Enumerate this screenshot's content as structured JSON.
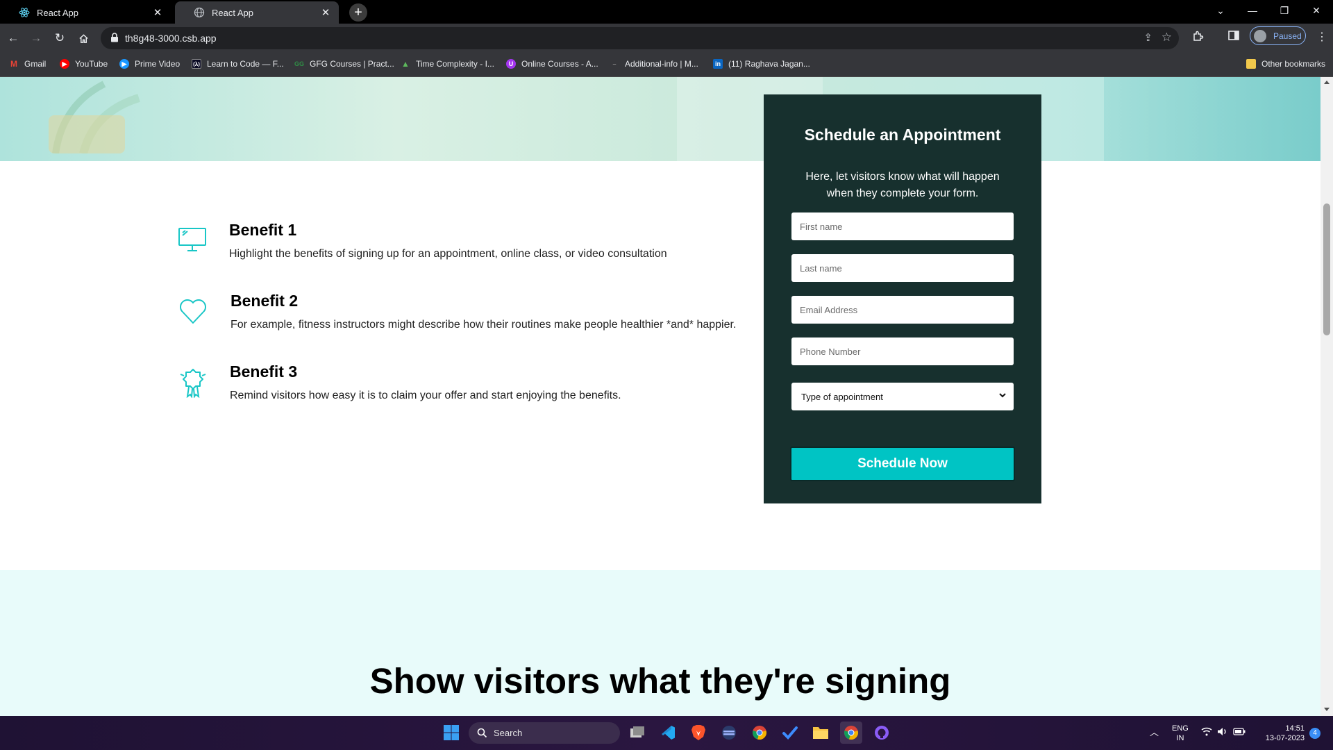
{
  "browser": {
    "tabs": [
      {
        "title": "React App",
        "active": false
      },
      {
        "title": "React App",
        "active": true
      }
    ],
    "url": "th8g48-3000.csb.app",
    "profile_status": "Paused",
    "bookmarks": [
      {
        "label": "Gmail",
        "icon": "gmail-icon",
        "color": "#ea4335"
      },
      {
        "label": "YouTube",
        "icon": "youtube-icon",
        "color": "#ff0000"
      },
      {
        "label": "Prime Video",
        "icon": "prime-video-icon",
        "color": "#1a98ff"
      },
      {
        "label": "Learn to Code — F...",
        "icon": "freecodecamp-icon",
        "color": "#0a0a23"
      },
      {
        "label": "GFG Courses | Pract...",
        "icon": "gfg-icon",
        "color": "#2f8d46"
      },
      {
        "label": "Time Complexity - I...",
        "icon": "mountain-icon",
        "color": "#5cb85c"
      },
      {
        "label": "Online Courses - A...",
        "icon": "udemy-icon",
        "color": "#a435f0"
      },
      {
        "label": "Additional-info | M...",
        "icon": "dash-icon",
        "color": "#555555"
      },
      {
        "label": "(11) Raghava Jagan...",
        "icon": "linkedin-icon",
        "color": "#0a66c2"
      }
    ],
    "other_bookmarks": "Other bookmarks"
  },
  "page": {
    "benefits": [
      {
        "title": "Benefit 1",
        "desc": "Highlight the benefits of signing up for an appointment, online class, or video consultation",
        "icon": "monitor-icon"
      },
      {
        "title": "Benefit 2",
        "desc": "For example, fitness instructors might describe how their routines make people healthier *and* happier.",
        "icon": "heart-icon"
      },
      {
        "title": "Benefit 3",
        "desc": "Remind visitors how easy it is to claim your offer and start enjoying the benefits.",
        "icon": "award-icon"
      }
    ],
    "form": {
      "title": "Schedule an Appointment",
      "subtitle": "Here, let visitors know what will happen when they complete your form.",
      "first_name_placeholder": "First name",
      "last_name_placeholder": "Last name",
      "email_placeholder": "Email Address",
      "phone_placeholder": "Phone Number",
      "appointment_type": "Type of appointment",
      "submit_label": "Schedule Now"
    },
    "section_heading": "Show visitors what they're signing",
    "colors": {
      "accent": "#00c4c4",
      "form_bg": "#17302e",
      "lower_bg": "#e8fbfa"
    }
  },
  "taskbar": {
    "search_label": "Search",
    "lang_top": "ENG",
    "lang_bottom": "IN",
    "time": "14:51",
    "date": "13-07-2023",
    "notification_count": "4"
  }
}
